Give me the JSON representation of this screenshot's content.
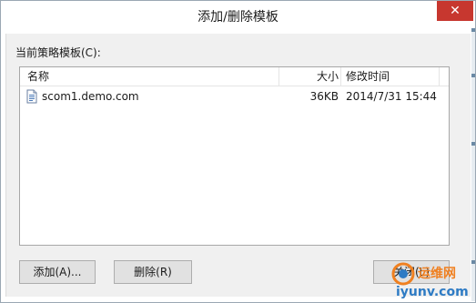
{
  "window": {
    "title": "添加/删除模板",
    "close_glyph": "✕",
    "accent": "#c7372f"
  },
  "group": {
    "label": "当前策略模板(C):"
  },
  "list": {
    "columns": [
      "名称",
      "大小",
      "修改时间"
    ],
    "rows": [
      {
        "name": "scom1.demo.com",
        "size": "36KB",
        "modified": "2014/7/31 15:44",
        "icon": "policy-file-icon"
      }
    ]
  },
  "buttons": {
    "add": "添加(A)...",
    "remove": "删除(R)",
    "close": "关闭(L)"
  },
  "watermark": {
    "brand_text": "运维网",
    "domain_text": "iyunv.com",
    "colors": [
      "#f08020",
      "#2e7bc4"
    ]
  }
}
